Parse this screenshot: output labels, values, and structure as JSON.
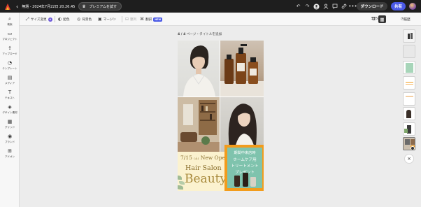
{
  "app": {
    "document_title": "無題 - 2024年7月22日 20.26.45",
    "premium_label": "プレミアムを試す",
    "download_label": "ダウンロード",
    "share_label": "共有"
  },
  "toolbar": {
    "resize_label": "サイズ変更",
    "copy_label": "配色",
    "color_label": "背景色",
    "margin_label": "マージン",
    "group_label": "整列",
    "translate_label": "翻訳",
    "new_badge": "NEW",
    "zoom_label": "57%",
    "history_label": "履歴"
  },
  "sidebar": {
    "items": [
      {
        "label": "検索",
        "icon": "search-icon"
      },
      {
        "label": "プロジェクト",
        "icon": "folder-icon"
      },
      {
        "label": "アップロード",
        "icon": "upload-icon"
      },
      {
        "label": "テンプレート",
        "icon": "template-icon"
      },
      {
        "label": "メディア",
        "icon": "media-icon"
      },
      {
        "label": "テキスト",
        "icon": "text-icon"
      },
      {
        "label": "デザイン素材",
        "icon": "shapes-icon"
      },
      {
        "label": "グリッド",
        "icon": "grid-icon"
      },
      {
        "label": "ブランド",
        "icon": "brand-icon"
      },
      {
        "label": "アドオン",
        "icon": "addons-icon"
      }
    ]
  },
  "canvas": {
    "page_counter": "4 / 4",
    "page_title_placeholder": "ページ・タイトルを追加"
  },
  "design": {
    "date": "7/15",
    "weekday": "(土)",
    "open_label": "New Open",
    "salon_label": "Hair Salon",
    "beauty_label": "Beauty",
    "promo_lines": [
      "期間中来店時",
      "ホームケア用",
      "トリートメント",
      "プレゼント"
    ]
  },
  "colors": {
    "accent": "#4a59e6",
    "promo_border": "#f29c1c",
    "promo_fill": "#7fc3ad",
    "promo_bg": "#fbf2cf",
    "gold_text": "#8a6f2c"
  }
}
